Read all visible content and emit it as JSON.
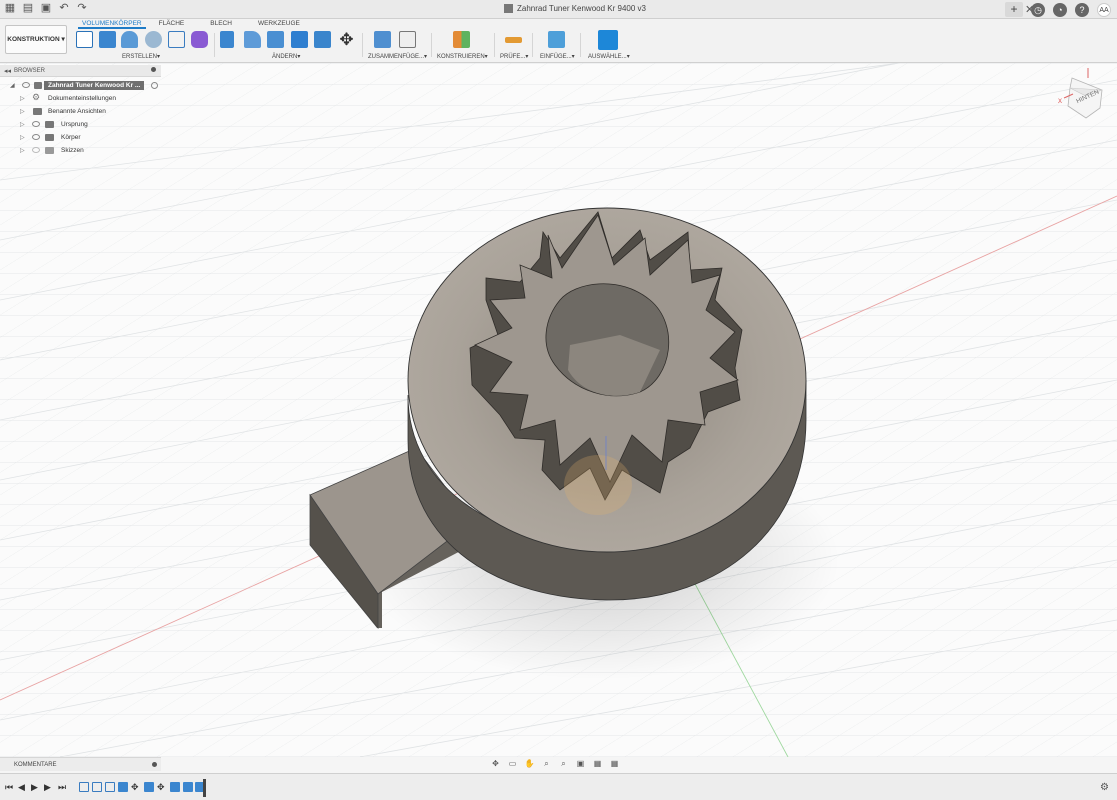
{
  "window": {
    "title": "Zahnrad Tuner Kenwood Kr 9400 v3"
  },
  "user": {
    "initials": "AA"
  },
  "toolbar": {
    "workspace": "KONSTRUKTION",
    "tabs": [
      "VOLUMENKÖRPER",
      "FLÄCHE",
      "BLECH",
      "WERKZEUGE"
    ],
    "active_tab": "VOLUMENKÖRPER",
    "groups": {
      "erstellen": "ERSTELLEN",
      "aendern": "ÄNDERN",
      "zusammenfuegen": "ZUSAMMENFÜGE...",
      "konstruieren": "KONSTRUIEREN",
      "pruefen": "PRÜFE...",
      "einfuegen": "EINFÜGE...",
      "auswaehlen": "AUSWÄHLE..."
    }
  },
  "browser": {
    "header": "BROWSER",
    "root": "Zahnrad Tuner Kenwood Kr ...",
    "items": [
      "Dokumenteinstellungen",
      "Benannte Ansichten",
      "Ursprung",
      "Körper",
      "Skizzen"
    ]
  },
  "comments": {
    "label": "KOMMENTARE"
  },
  "viewcube": {
    "label": "HINTEN",
    "axis_x": "X"
  },
  "colors": {
    "accent": "#1f7cc7",
    "part_top": "#a7a098",
    "part_side": "#5f5b55",
    "grid": "#d9dde0",
    "axis_red": "#e58a8a",
    "axis_green": "#8fd08f"
  }
}
